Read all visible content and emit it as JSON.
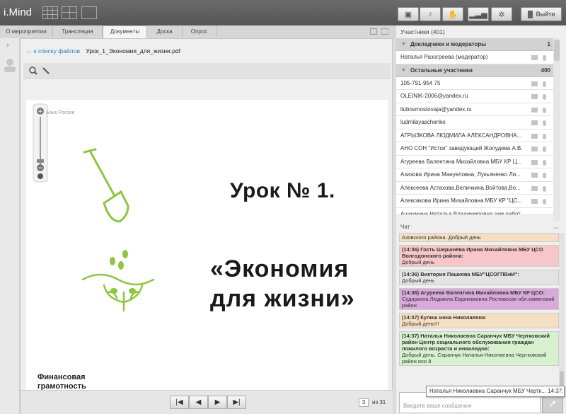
{
  "app": {
    "title": "i.Mind",
    "exit_label": "Выйти",
    "dots": "• •"
  },
  "controls": [
    "camera-off-icon",
    "mic-off-icon",
    "hand-icon",
    "signal-icon",
    "gear-icon"
  ],
  "tabs": [
    "О мероприятии",
    "Трансляция",
    "Документы",
    "Доска",
    "Опрос"
  ],
  "doc": {
    "back_link": "← к списку файлов",
    "filename": "Урок_1_Экономия_для_жизни.pdf",
    "slide": {
      "bank_label": "Банк России",
      "lesson": "Урок № 1.",
      "title_line1": "«Экономия",
      "title_line2": "для жизни»",
      "footer_line1": "Финансовая",
      "footer_line2": "грамотность"
    },
    "page": "3",
    "of_total": "из 31",
    "accent": "#8dc63f"
  },
  "participants": {
    "header": "Участники (401)",
    "groups": [
      {
        "title": "Докладчики и модераторы",
        "count": "1",
        "items": [
          "Наталья Разогреева (модератор)"
        ]
      },
      {
        "title": "Остальные участники",
        "count": "400",
        "items": [
          "105-791-954 75",
          "OLEINIK-2006@yandex.ru",
          "liubovmostovaja@yandex.ru",
          "ludmilayaschenko",
          "АГРЫЗКОВА ЛЮДМИЛА АЛЕКСАНДРОВНА...",
          "АНО СОН \"Исток\" заведующий Жолудева А.В.",
          "Агуреева Валентина Михайловна МБУ КР Ц...",
          "Азизова Ирина Мануеловна, Лукьяненко Ли...",
          "Алексеева Астахова,Величкина,Войтова,Во...",
          "Алексикова Ирина Михайловна МБУ КР \"ЦС...",
          "Ашихмина Наталья Владимировна зам.работ..."
        ]
      }
    ]
  },
  "chat": {
    "header": "Чат",
    "messages": [
      {
        "author": "",
        "text": "Азовского района. Добрый день"
      },
      {
        "author": "(14:36) Гость Шершнёва Ирина Михайловна МБУ ЦСО Волгодонского района:",
        "text": "Добрый день"
      },
      {
        "author": "(14:36) Виктория Пашкова МБУ\"ЦСОГПВиИ\":",
        "text": "Добрый день"
      },
      {
        "author": "(14:36) Агуреева Валентина Михайловна МБУ КР ЦСО:",
        "text": "Сударкина Людмила Евдокимовна Ростовская обл.каменский район"
      },
      {
        "author": "(14:37) Кулиш инна Николаевна:",
        "text": "Добрый день!!!"
      },
      {
        "author": "(14:37) Наталья Николаевна Саранчук МБУ Чертковский район Центр социального обслуживания граждан пожилого возраста и инвалидов:",
        "text": "Добрый день. Саранчук Наталья Николаевна Чертковский район осо 8"
      }
    ],
    "input_placeholder": "Введите ваше сообщение",
    "tooltip": "Наталья Николаевна Саранчук МБУ Чертк... 14:37:13"
  }
}
